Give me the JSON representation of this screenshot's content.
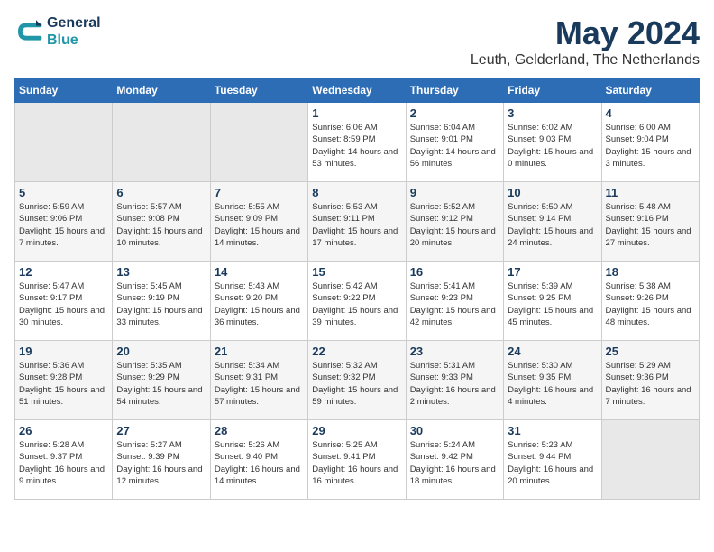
{
  "header": {
    "logo_line1": "General",
    "logo_line2": "Blue",
    "month_title": "May 2024",
    "location": "Leuth, Gelderland, The Netherlands"
  },
  "days_of_week": [
    "Sunday",
    "Monday",
    "Tuesday",
    "Wednesday",
    "Thursday",
    "Friday",
    "Saturday"
  ],
  "weeks": [
    [
      {
        "num": "",
        "info": ""
      },
      {
        "num": "",
        "info": ""
      },
      {
        "num": "",
        "info": ""
      },
      {
        "num": "1",
        "info": "Sunrise: 6:06 AM\nSunset: 8:59 PM\nDaylight: 14 hours and 53 minutes."
      },
      {
        "num": "2",
        "info": "Sunrise: 6:04 AM\nSunset: 9:01 PM\nDaylight: 14 hours and 56 minutes."
      },
      {
        "num": "3",
        "info": "Sunrise: 6:02 AM\nSunset: 9:03 PM\nDaylight: 15 hours and 0 minutes."
      },
      {
        "num": "4",
        "info": "Sunrise: 6:00 AM\nSunset: 9:04 PM\nDaylight: 15 hours and 3 minutes."
      }
    ],
    [
      {
        "num": "5",
        "info": "Sunrise: 5:59 AM\nSunset: 9:06 PM\nDaylight: 15 hours and 7 minutes."
      },
      {
        "num": "6",
        "info": "Sunrise: 5:57 AM\nSunset: 9:08 PM\nDaylight: 15 hours and 10 minutes."
      },
      {
        "num": "7",
        "info": "Sunrise: 5:55 AM\nSunset: 9:09 PM\nDaylight: 15 hours and 14 minutes."
      },
      {
        "num": "8",
        "info": "Sunrise: 5:53 AM\nSunset: 9:11 PM\nDaylight: 15 hours and 17 minutes."
      },
      {
        "num": "9",
        "info": "Sunrise: 5:52 AM\nSunset: 9:12 PM\nDaylight: 15 hours and 20 minutes."
      },
      {
        "num": "10",
        "info": "Sunrise: 5:50 AM\nSunset: 9:14 PM\nDaylight: 15 hours and 24 minutes."
      },
      {
        "num": "11",
        "info": "Sunrise: 5:48 AM\nSunset: 9:16 PM\nDaylight: 15 hours and 27 minutes."
      }
    ],
    [
      {
        "num": "12",
        "info": "Sunrise: 5:47 AM\nSunset: 9:17 PM\nDaylight: 15 hours and 30 minutes."
      },
      {
        "num": "13",
        "info": "Sunrise: 5:45 AM\nSunset: 9:19 PM\nDaylight: 15 hours and 33 minutes."
      },
      {
        "num": "14",
        "info": "Sunrise: 5:43 AM\nSunset: 9:20 PM\nDaylight: 15 hours and 36 minutes."
      },
      {
        "num": "15",
        "info": "Sunrise: 5:42 AM\nSunset: 9:22 PM\nDaylight: 15 hours and 39 minutes."
      },
      {
        "num": "16",
        "info": "Sunrise: 5:41 AM\nSunset: 9:23 PM\nDaylight: 15 hours and 42 minutes."
      },
      {
        "num": "17",
        "info": "Sunrise: 5:39 AM\nSunset: 9:25 PM\nDaylight: 15 hours and 45 minutes."
      },
      {
        "num": "18",
        "info": "Sunrise: 5:38 AM\nSunset: 9:26 PM\nDaylight: 15 hours and 48 minutes."
      }
    ],
    [
      {
        "num": "19",
        "info": "Sunrise: 5:36 AM\nSunset: 9:28 PM\nDaylight: 15 hours and 51 minutes."
      },
      {
        "num": "20",
        "info": "Sunrise: 5:35 AM\nSunset: 9:29 PM\nDaylight: 15 hours and 54 minutes."
      },
      {
        "num": "21",
        "info": "Sunrise: 5:34 AM\nSunset: 9:31 PM\nDaylight: 15 hours and 57 minutes."
      },
      {
        "num": "22",
        "info": "Sunrise: 5:32 AM\nSunset: 9:32 PM\nDaylight: 15 hours and 59 minutes."
      },
      {
        "num": "23",
        "info": "Sunrise: 5:31 AM\nSunset: 9:33 PM\nDaylight: 16 hours and 2 minutes."
      },
      {
        "num": "24",
        "info": "Sunrise: 5:30 AM\nSunset: 9:35 PM\nDaylight: 16 hours and 4 minutes."
      },
      {
        "num": "25",
        "info": "Sunrise: 5:29 AM\nSunset: 9:36 PM\nDaylight: 16 hours and 7 minutes."
      }
    ],
    [
      {
        "num": "26",
        "info": "Sunrise: 5:28 AM\nSunset: 9:37 PM\nDaylight: 16 hours and 9 minutes."
      },
      {
        "num": "27",
        "info": "Sunrise: 5:27 AM\nSunset: 9:39 PM\nDaylight: 16 hours and 12 minutes."
      },
      {
        "num": "28",
        "info": "Sunrise: 5:26 AM\nSunset: 9:40 PM\nDaylight: 16 hours and 14 minutes."
      },
      {
        "num": "29",
        "info": "Sunrise: 5:25 AM\nSunset: 9:41 PM\nDaylight: 16 hours and 16 minutes."
      },
      {
        "num": "30",
        "info": "Sunrise: 5:24 AM\nSunset: 9:42 PM\nDaylight: 16 hours and 18 minutes."
      },
      {
        "num": "31",
        "info": "Sunrise: 5:23 AM\nSunset: 9:44 PM\nDaylight: 16 hours and 20 minutes."
      },
      {
        "num": "",
        "info": ""
      }
    ]
  ]
}
